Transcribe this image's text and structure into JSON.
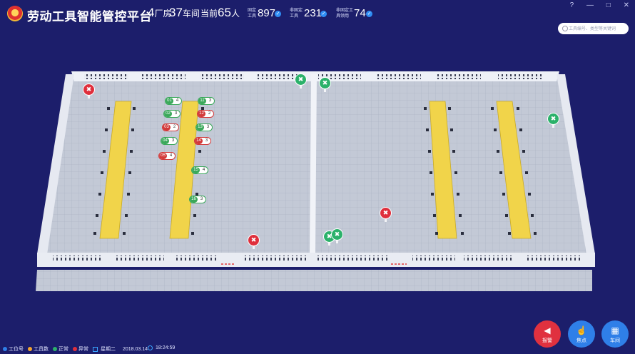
{
  "header": {
    "title": "劳动工具智能管控平台",
    "factory_count": "4",
    "factory_unit": "厂房",
    "workshop_count": "37",
    "workshop_unit": "车间",
    "current_label": "当前",
    "current_count": "65",
    "current_unit": "人",
    "fixed_tools_label": [
      "固定",
      "工具"
    ],
    "fixed_tools_value": "897",
    "nonfixed_tools_label": [
      "非固定",
      "工具"
    ],
    "nonfixed_tools_value": "231",
    "nonfixed_used_label": [
      "非固定工",
      "具领用"
    ],
    "nonfixed_used_value": "74"
  },
  "window_controls": [
    "?",
    "—",
    "□",
    "✕"
  ],
  "search": {
    "placeholder": "工具编号、类型等关键词"
  },
  "legend": [
    {
      "label": "工位号",
      "color": "#2f7fe8"
    },
    {
      "label": "工具数",
      "color": "#f3a530"
    },
    {
      "label": "正常",
      "color": "#2bb16a"
    },
    {
      "label": "异常",
      "color": "#df2f3c"
    }
  ],
  "date": {
    "weekday": "星期二",
    "date": "2018.03.14",
    "time": "18:24:59"
  },
  "workstation_tags": [
    {
      "num": "01",
      "count": "4",
      "status": "normal"
    },
    {
      "num": "02",
      "count": "3",
      "status": "normal"
    },
    {
      "num": "03",
      "count": "2",
      "status": "abnormal"
    },
    {
      "num": "04",
      "count": "3",
      "status": "normal"
    },
    {
      "num": "05",
      "count": "4",
      "status": "abnormal"
    },
    {
      "num": "11",
      "count": "3",
      "status": "normal"
    },
    {
      "num": "12",
      "count": "2",
      "status": "abnormal"
    },
    {
      "num": "13",
      "count": "3",
      "status": "normal"
    },
    {
      "num": "14",
      "count": "3",
      "status": "abnormal"
    },
    {
      "num": "15",
      "count": "4",
      "status": "normal"
    },
    {
      "num": "16",
      "count": "3",
      "status": "normal"
    }
  ],
  "markers": [
    {
      "status": "abnormal",
      "icon": "wrench-icon"
    },
    {
      "status": "normal",
      "icon": "wrench-icon"
    },
    {
      "status": "normal",
      "icon": "wrench-icon"
    },
    {
      "status": "normal",
      "icon": "wrench-icon"
    },
    {
      "status": "abnormal",
      "icon": "wrench-icon"
    },
    {
      "status": "abnormal",
      "icon": "wrench-icon"
    },
    {
      "status": "normal",
      "icon": "wrench-icon"
    },
    {
      "status": "normal",
      "icon": "wrench-icon"
    }
  ],
  "actions": {
    "alarm": "报警",
    "focus": "焦点",
    "workshop": "车间"
  },
  "colors": {
    "background": "#1c1e6b",
    "floor": "#bfc5d3",
    "bench": "#f1d44a",
    "normal": "#2bb16a",
    "abnormal": "#df2f3c",
    "accent": "#2f7fe8"
  }
}
